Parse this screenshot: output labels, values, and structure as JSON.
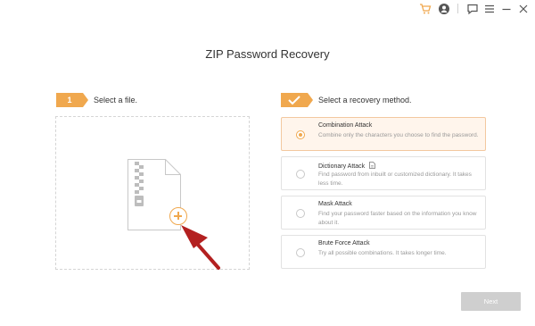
{
  "colors": {
    "accent": "#f0a84e",
    "disabled": "#cfcfcf",
    "selected_bg": "#fff5ec"
  },
  "topbar": {
    "icons": [
      "cart-icon",
      "account-icon",
      "feedback-icon",
      "menu-icon",
      "minimize-icon",
      "close-icon"
    ]
  },
  "title": "ZIP Password Recovery",
  "step1": {
    "number": "1",
    "label": "Select a file."
  },
  "step2": {
    "icon": "check-icon",
    "label": "Select a recovery method."
  },
  "methods": [
    {
      "title": "Combination Attack",
      "desc": "Combine only the characters you choose to find the password.",
      "selected": true
    },
    {
      "title": "Dictionary Attack",
      "desc": "Find password from inbuilt or customized dictionary. It takes less time.",
      "selected": false,
      "icon": "document-icon"
    },
    {
      "title": "Mask Attack",
      "desc": "Find your password faster based on the information you know about it.",
      "selected": false
    },
    {
      "title": "Brute Force Attack",
      "desc": "Try all possible combinations. It takes longer time.",
      "selected": false
    }
  ],
  "next_label": "Next"
}
